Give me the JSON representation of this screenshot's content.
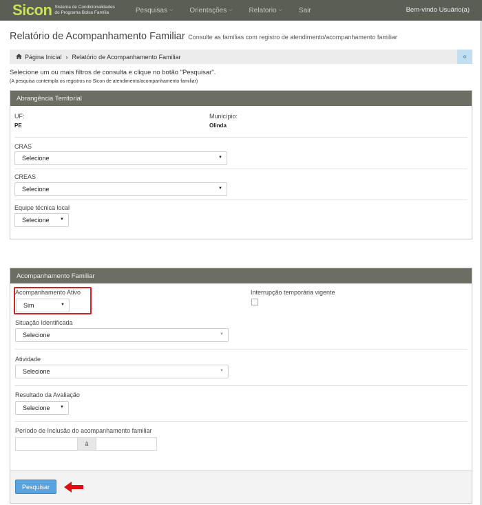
{
  "brand": {
    "logo": "Sicon",
    "subtitle_line1": "Sistema de Condicionalidades",
    "subtitle_line2": "do Programa Bolsa Família"
  },
  "nav": {
    "items": [
      {
        "label": "Pesquisas",
        "chevron": "⌵"
      },
      {
        "label": "Orientações",
        "chevron": "⌵"
      },
      {
        "label": "Relatorio",
        "chevron": "⌵"
      },
      {
        "label": "Sair",
        "chevron": ""
      }
    ],
    "welcome": "Bem-vindo Usuário(a)"
  },
  "page": {
    "title": "Relatório de Acompanhamento Familiar",
    "subtitle": "Consulte as famílias com registro de atendimento/acompanhamento familiar"
  },
  "breadcrumb": {
    "home": "Página Inicial",
    "separator": "›",
    "current": "Relatório de Acompanhamento Familiar",
    "collapse": "«"
  },
  "instructions": {
    "line1": "Selecione um ou mais filtros de consulta e clique no botão \"Pesquisar\".",
    "line2": "(A pesquisa contempla os registros no Sicon de atendimento/acompanhamento familiar)"
  },
  "territorial": {
    "title": "Abrangência Territorial",
    "uf_label": "UF:",
    "uf_value": "PE",
    "municipio_label": "Município:",
    "municipio_value": "Olinda",
    "cras_label": "CRAS",
    "cras_value": "Selecione",
    "creas_label": "CREAS",
    "creas_value": "Selecione",
    "equipe_label": "Equipe técnica local",
    "equipe_value": "Selecione"
  },
  "acompanhamento": {
    "title": "Acompanhamento Familiar",
    "ativo_label": "Acompanhamento Ativo",
    "ativo_value": "Sim",
    "interrupcao_label": "Interrupção temporária vigente",
    "situacao_label": "Situação Identificada",
    "situacao_value": "Selecione",
    "atividade_label": "Atividade",
    "atividade_value": "Selecione",
    "resultado_label": "Resultado da Avaliação",
    "resultado_value": "Selecione",
    "periodo_label": "Período de Inclusão do acompanhamento familiar",
    "periodo_sep": "à",
    "periodo_start": "",
    "periodo_end": ""
  },
  "actions": {
    "search_label": "Pesquisar"
  },
  "colors": {
    "nav_bg": "#5b5e55",
    "logo": "#c7e25a",
    "panel_head": "#6c6e64",
    "button": "#58a3e0",
    "highlight": "#d81e1e"
  }
}
